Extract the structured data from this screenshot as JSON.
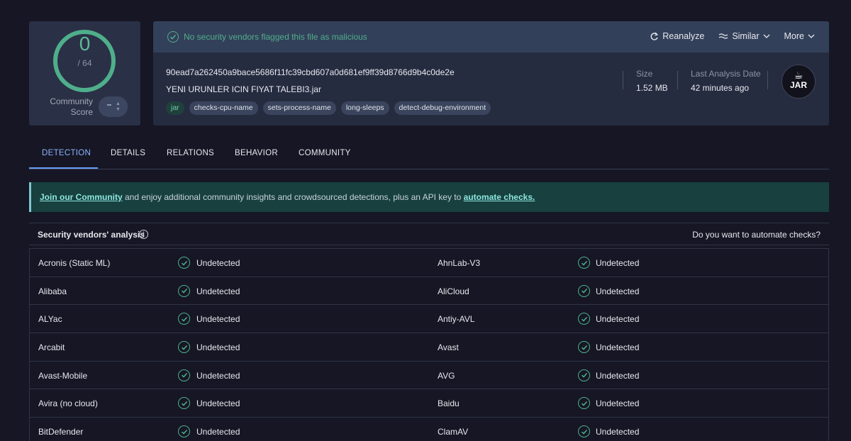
{
  "score": {
    "detections": "0",
    "total": "/ 64",
    "community_label_1": "Community",
    "community_label_2": "Score"
  },
  "banner_top": {
    "flag_text": "No security vendors flagged this file as malicious"
  },
  "actions": {
    "reanalyze": "Reanalyze",
    "similar": "Similar",
    "more": "More"
  },
  "file": {
    "hash": "90ead7a262450a9bace5686f11fc39cbd607a0d681ef9ff39d8766d9b4c0de2e",
    "name": "YENI URUNLER ICIN FIYAT TALEBI3.jar",
    "tags": [
      "jar",
      "checks-cpu-name",
      "sets-process-name",
      "long-sleeps",
      "detect-debug-environment"
    ],
    "size_label": "Size",
    "size_value": "1.52 MB",
    "date_label": "Last Analysis Date",
    "date_value": "42 minutes ago",
    "type_badge": "JAR"
  },
  "tabs": [
    "DETECTION",
    "DETAILS",
    "RELATIONS",
    "BEHAVIOR",
    "COMMUNITY"
  ],
  "community_banner": {
    "link1": "Join our Community",
    "middle": " and enjoy additional community insights and crowdsourced detections, plus an API key to ",
    "link2": "automate checks."
  },
  "analysis": {
    "title": "Security vendors' analysis",
    "automate_question": "Do you want to automate checks?"
  },
  "vendors": [
    {
      "left": "Acronis (Static ML)",
      "left_result": "Undetected",
      "right": "AhnLab-V3",
      "right_result": "Undetected"
    },
    {
      "left": "Alibaba",
      "left_result": "Undetected",
      "right": "AliCloud",
      "right_result": "Undetected"
    },
    {
      "left": "ALYac",
      "left_result": "Undetected",
      "right": "Antiy-AVL",
      "right_result": "Undetected"
    },
    {
      "left": "Arcabit",
      "left_result": "Undetected",
      "right": "Avast",
      "right_result": "Undetected"
    },
    {
      "left": "Avast-Mobile",
      "left_result": "Undetected",
      "right": "AVG",
      "right_result": "Undetected"
    },
    {
      "left": "Avira (no cloud)",
      "left_result": "Undetected",
      "right": "Baidu",
      "right_result": "Undetected"
    },
    {
      "left": "BitDefender",
      "left_result": "Undetected",
      "right": "ClamAV",
      "right_result": "Undetected"
    }
  ],
  "colors": {
    "accent_green": "#4fae8b",
    "tab_active": "#8ab4ff",
    "banner_bg": "#17403f"
  }
}
